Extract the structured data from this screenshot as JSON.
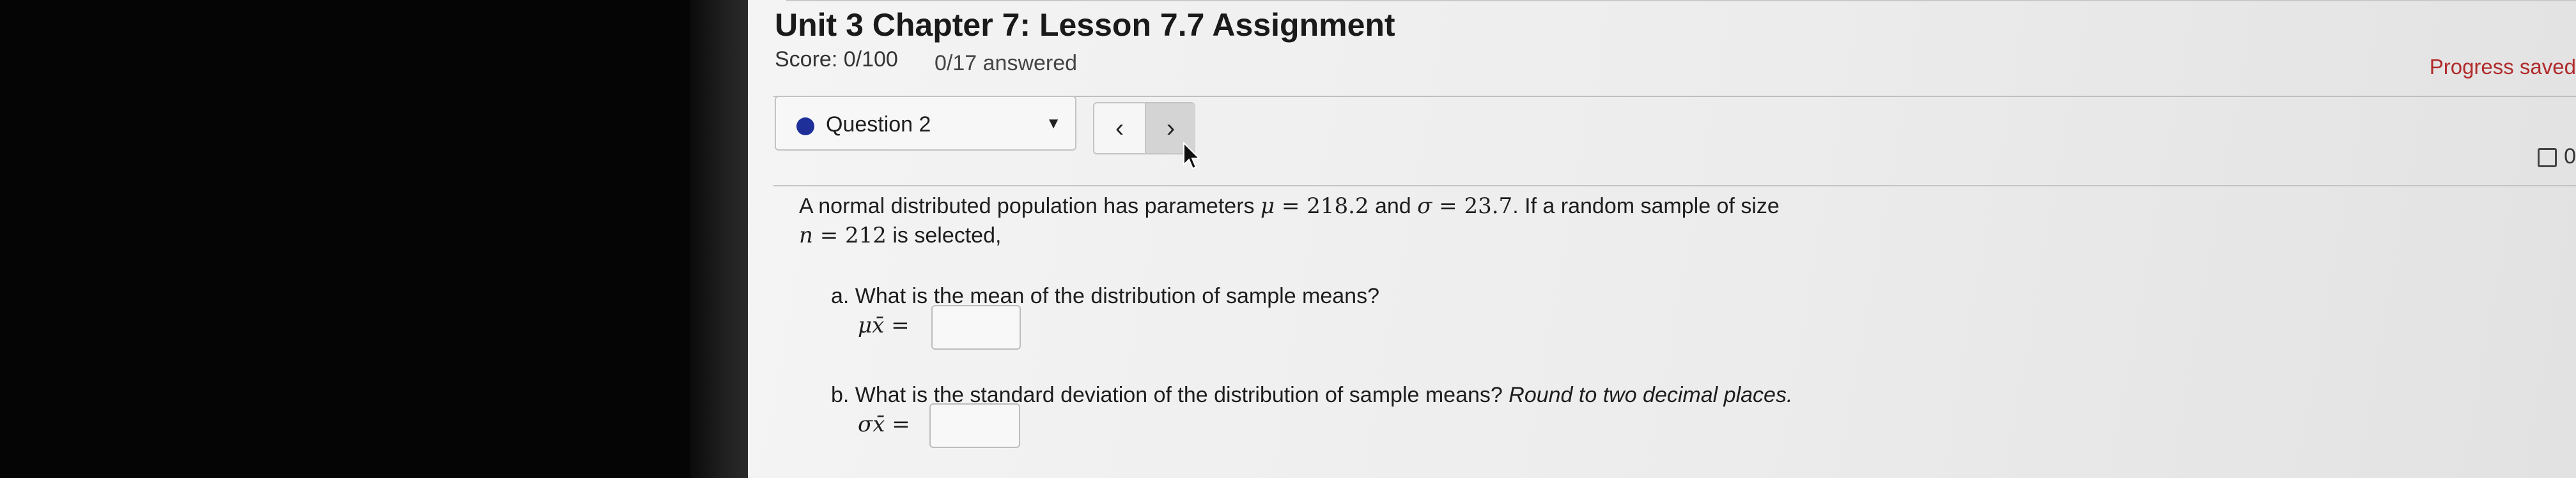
{
  "header": {
    "title": "Unit 3 Chapter 7: Lesson 7.7 Assignment",
    "score": "Score: 0/100",
    "answered": "0/17 answered",
    "progress_status": "Progress saved"
  },
  "question_nav": {
    "selected_question": "Question 2",
    "prev_symbol": "‹",
    "next_symbol": "›",
    "caret_symbol": "▼",
    "checkbox_count": "0"
  },
  "problem": {
    "intro_1": "A normal distributed population has parameters ",
    "mu_sym": "μ",
    "eq1": " = ",
    "mu_val": "218.2",
    "and_text": " and ",
    "sigma_sym": "σ",
    "eq2": " = ",
    "sigma_val": "23.7",
    "intro_2": ". If a random sample of size",
    "n_sym": "n",
    "eq3": " = ",
    "n_val": "212",
    "intro_3": " is selected,"
  },
  "part_a": {
    "question": "a. What is the mean of the distribution of sample means?",
    "answer_label": "μx̄ =",
    "answer_value": ""
  },
  "part_b": {
    "question": "b. What is the standard deviation of the distribution of sample means? ",
    "instruction": "Round to two decimal places.",
    "answer_label": "σx̄ =",
    "answer_value": ""
  },
  "colors": {
    "question_dot": "#1f2f9a",
    "progress_text": "#b12a2a",
    "page_bg": "#ececec"
  }
}
